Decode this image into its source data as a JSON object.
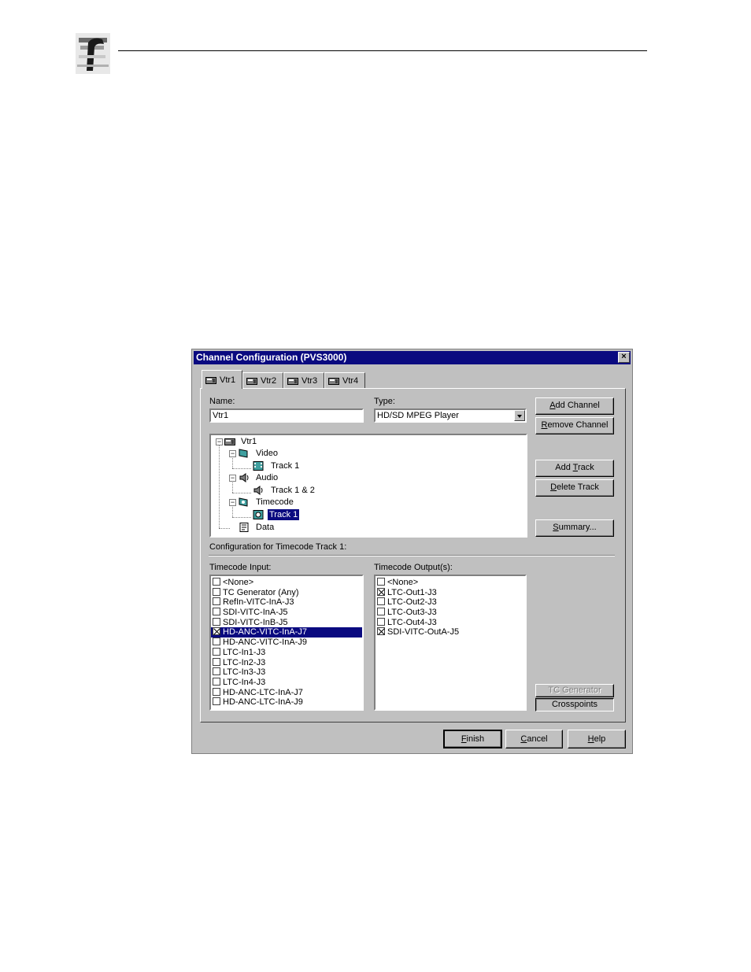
{
  "dialog": {
    "title": "Channel Configuration (PVS3000)",
    "close_glyph": "×"
  },
  "tabs": [
    {
      "label": "Vtr1",
      "icon": "vtr-icon",
      "active": true
    },
    {
      "label": "Vtr2",
      "icon": "vtr-icon",
      "active": false
    },
    {
      "label": "Vtr3",
      "icon": "vtr-icon",
      "active": false
    },
    {
      "label": "Vtr4",
      "icon": "vtr-icon",
      "active": false
    }
  ],
  "name_field": {
    "label": "Name:",
    "value": "Vtr1"
  },
  "type_field": {
    "label": "Type:",
    "value": "HD/SD MPEG Player"
  },
  "buttons": {
    "add_channel": {
      "pre": "",
      "key": "A",
      "post": "dd Channel"
    },
    "remove_channel": {
      "pre": "",
      "key": "R",
      "post": "emove Channel"
    },
    "add_track": {
      "pre": "Add ",
      "key": "T",
      "post": "rack"
    },
    "delete_track": {
      "pre": "",
      "key": "D",
      "post": "elete Track"
    },
    "summary": {
      "pre": "",
      "key": "S",
      "post": "ummary..."
    },
    "tc_generator": "TC Generator",
    "crosspoints": "Crosspoints",
    "finish": {
      "pre": "",
      "key": "F",
      "post": "inish"
    },
    "cancel": {
      "pre": "",
      "key": "C",
      "post": "ancel"
    },
    "help": {
      "pre": "",
      "key": "H",
      "post": "elp"
    }
  },
  "tree": {
    "root": "Vtr1",
    "video": "Video",
    "video_track": "Track 1",
    "audio": "Audio",
    "audio_track": "Track 1 & 2",
    "timecode": "Timecode",
    "timecode_track": "Track 1",
    "data": "Data",
    "expand_glyph": "−"
  },
  "config_label": "Configuration for Timecode Track 1:",
  "timecode_input": {
    "label": "Timecode Input:",
    "items": [
      {
        "text": "<None>",
        "checked": false,
        "selected": false
      },
      {
        "text": "TC Generator (Any)",
        "checked": false,
        "selected": false
      },
      {
        "text": "RefIn-VITC-InA-J3",
        "checked": false,
        "selected": false
      },
      {
        "text": "SDI-VITC-InA-J5",
        "checked": false,
        "selected": false
      },
      {
        "text": "SDI-VITC-InB-J5",
        "checked": false,
        "selected": false
      },
      {
        "text": "HD-ANC-VITC-InA-J7",
        "checked": true,
        "selected": true
      },
      {
        "text": "HD-ANC-VITC-InA-J9",
        "checked": false,
        "selected": false
      },
      {
        "text": "LTC-In1-J3",
        "checked": false,
        "selected": false
      },
      {
        "text": "LTC-In2-J3",
        "checked": false,
        "selected": false
      },
      {
        "text": "LTC-In3-J3",
        "checked": false,
        "selected": false
      },
      {
        "text": "LTC-In4-J3",
        "checked": false,
        "selected": false
      },
      {
        "text": "HD-ANC-LTC-InA-J7",
        "checked": false,
        "selected": false
      },
      {
        "text": "HD-ANC-LTC-InA-J9",
        "checked": false,
        "selected": false
      }
    ]
  },
  "timecode_output": {
    "label": "Timecode Output(s):",
    "items": [
      {
        "text": "<None>",
        "checked": false,
        "selected": false
      },
      {
        "text": "LTC-Out1-J3",
        "checked": true,
        "selected": false
      },
      {
        "text": "LTC-Out2-J3",
        "checked": false,
        "selected": false
      },
      {
        "text": "LTC-Out3-J3",
        "checked": false,
        "selected": false
      },
      {
        "text": "LTC-Out4-J3",
        "checked": false,
        "selected": false
      },
      {
        "text": "SDI-VITC-OutA-J5",
        "checked": true,
        "selected": false
      }
    ]
  },
  "colors": {
    "face": "#c0c0c0",
    "title_bar": "#0a0a80",
    "selection": "#0a0a80"
  }
}
